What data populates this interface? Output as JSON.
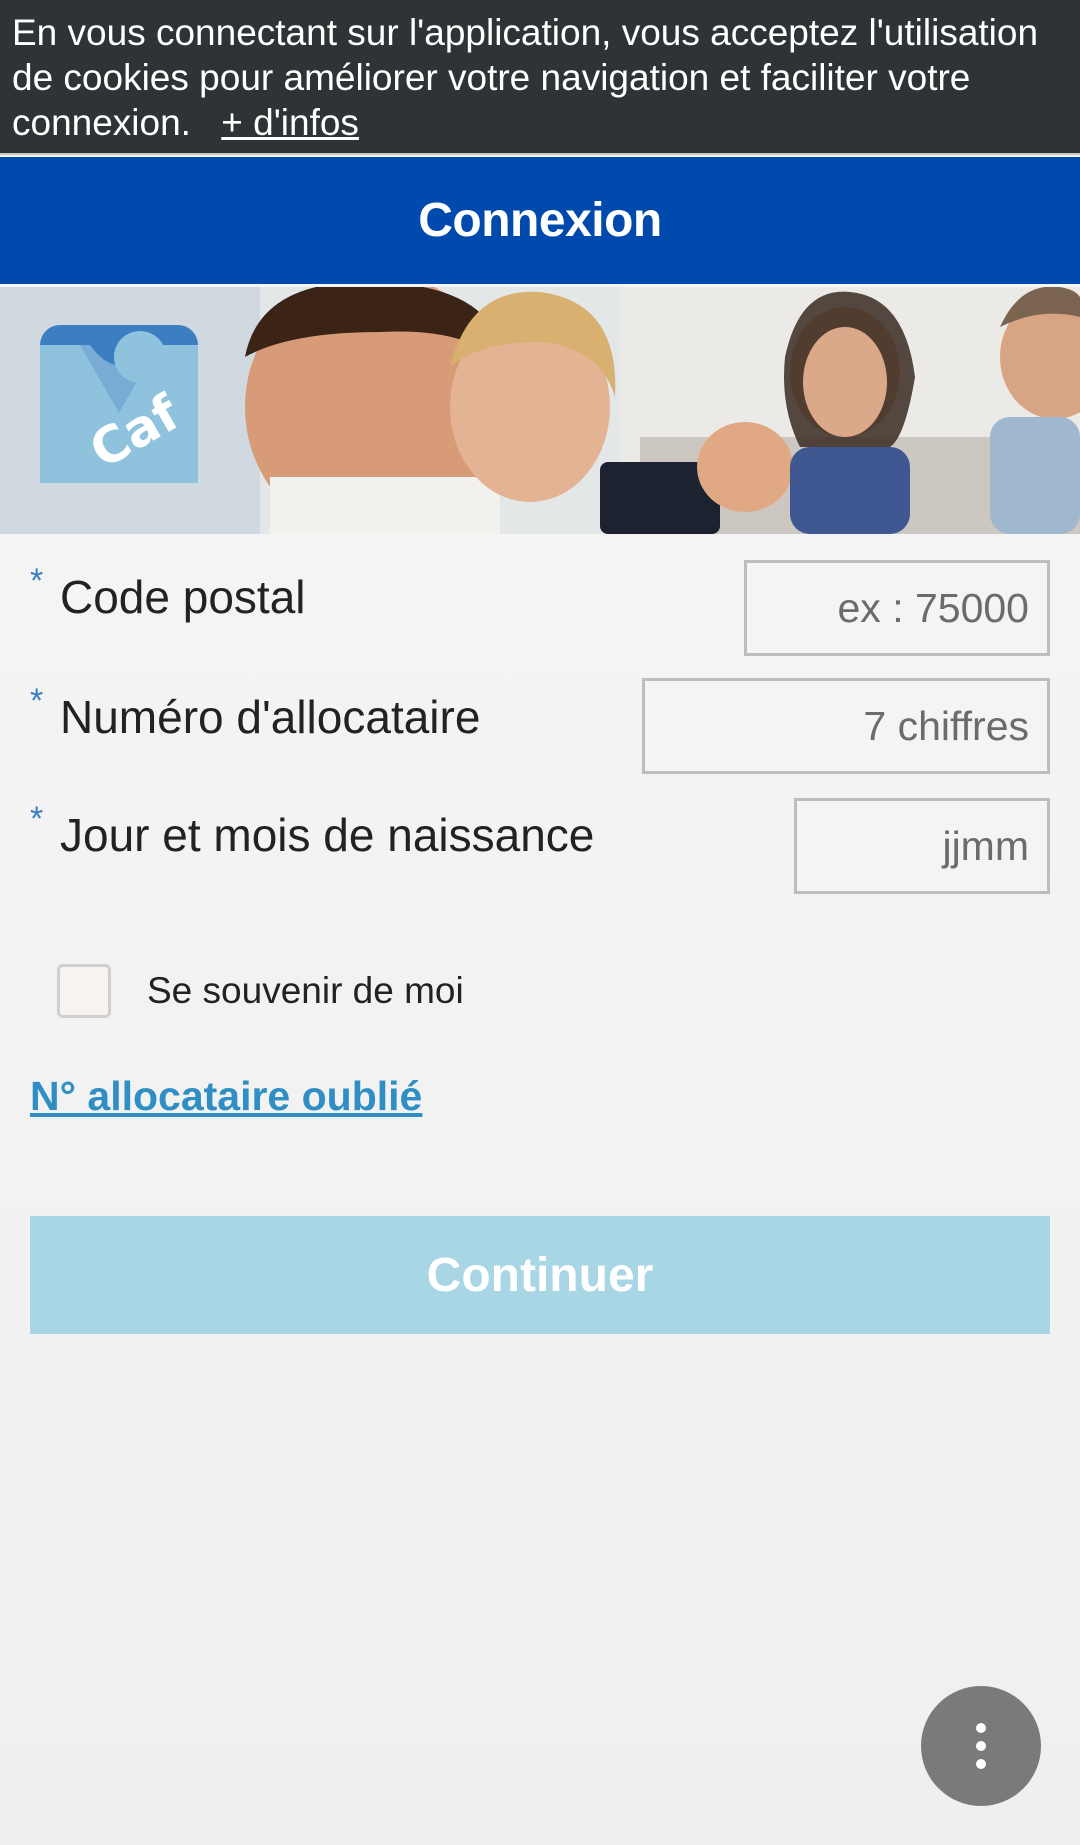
{
  "cookie_banner": {
    "text": "En vous connectant sur l'application, vous acceptez l'utilisation de cookies pour améliorer votre navigation et faciliter votre connexion.",
    "more_link": "+ d'infos"
  },
  "header": {
    "title": "Connexion"
  },
  "hero": {
    "logo_text": "Caf",
    "logo_color": "#3c7ec2"
  },
  "form": {
    "required_mark": "*",
    "postal_code": {
      "label": "Code postal",
      "placeholder": "ex : 75000",
      "value": ""
    },
    "allocataire_number": {
      "label": "Numéro d'allocataire",
      "placeholder": "7 chiffres",
      "value": ""
    },
    "birth_day_month": {
      "label": "Jour et mois de naissance",
      "placeholder": "jjmm",
      "value": ""
    },
    "remember_me": {
      "label": "Se souvenir de moi",
      "checked": false
    },
    "forgot_link": "N° allocataire oublié",
    "continue_label": "Continuer"
  },
  "fab": {
    "icon": "more-vertical-icon"
  },
  "colors": {
    "banner_bg": "#2e3436",
    "header_bg": "#004aad",
    "link": "#2f8ec4",
    "button_disabled": "#a8d6e5",
    "fab_bg": "#7a7a7a"
  }
}
